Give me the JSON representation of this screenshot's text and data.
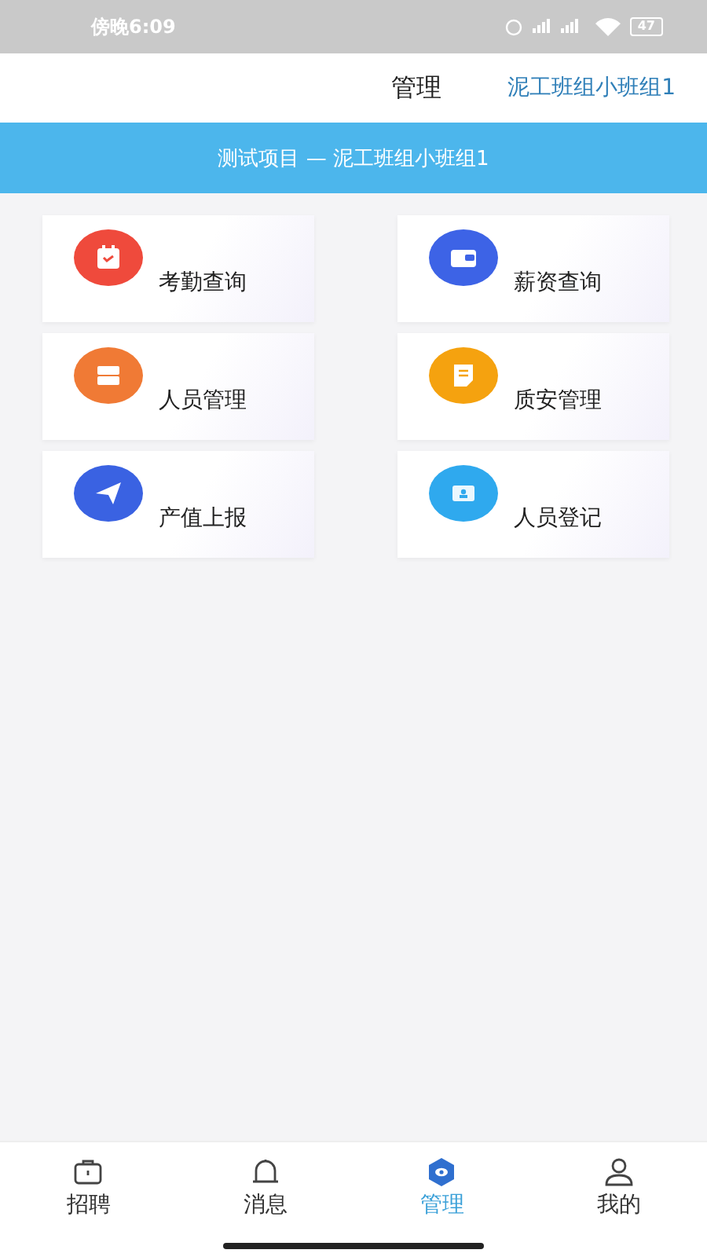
{
  "status_bar": {
    "time": "傍晚6:09",
    "battery": "47"
  },
  "header": {
    "title": "管理",
    "team": "泥工班组小班组1"
  },
  "banner": {
    "text": "测试项目 — 泥工班组小班组1"
  },
  "modules": [
    {
      "label": "考勤查询",
      "kind": "calendar",
      "color": "#ef4a3c"
    },
    {
      "label": "薪资查询",
      "kind": "wallet",
      "color": "#3d63e6"
    },
    {
      "label": "人员管理",
      "kind": "cabinet",
      "color": "#f07a35"
    },
    {
      "label": "质安管理",
      "kind": "document",
      "color": "#f5a20f"
    },
    {
      "label": "产值上报",
      "kind": "plane",
      "color": "#3a62e2"
    },
    {
      "label": "人员登记",
      "kind": "idcard",
      "color": "#2fa9ee"
    }
  ],
  "tabs": [
    {
      "label": "招聘",
      "kind": "briefcase",
      "selected": false
    },
    {
      "label": "消息",
      "kind": "bell",
      "selected": false
    },
    {
      "label": "管理",
      "kind": "hexagon",
      "selected": true
    },
    {
      "label": "我的",
      "kind": "person",
      "selected": false
    }
  ]
}
